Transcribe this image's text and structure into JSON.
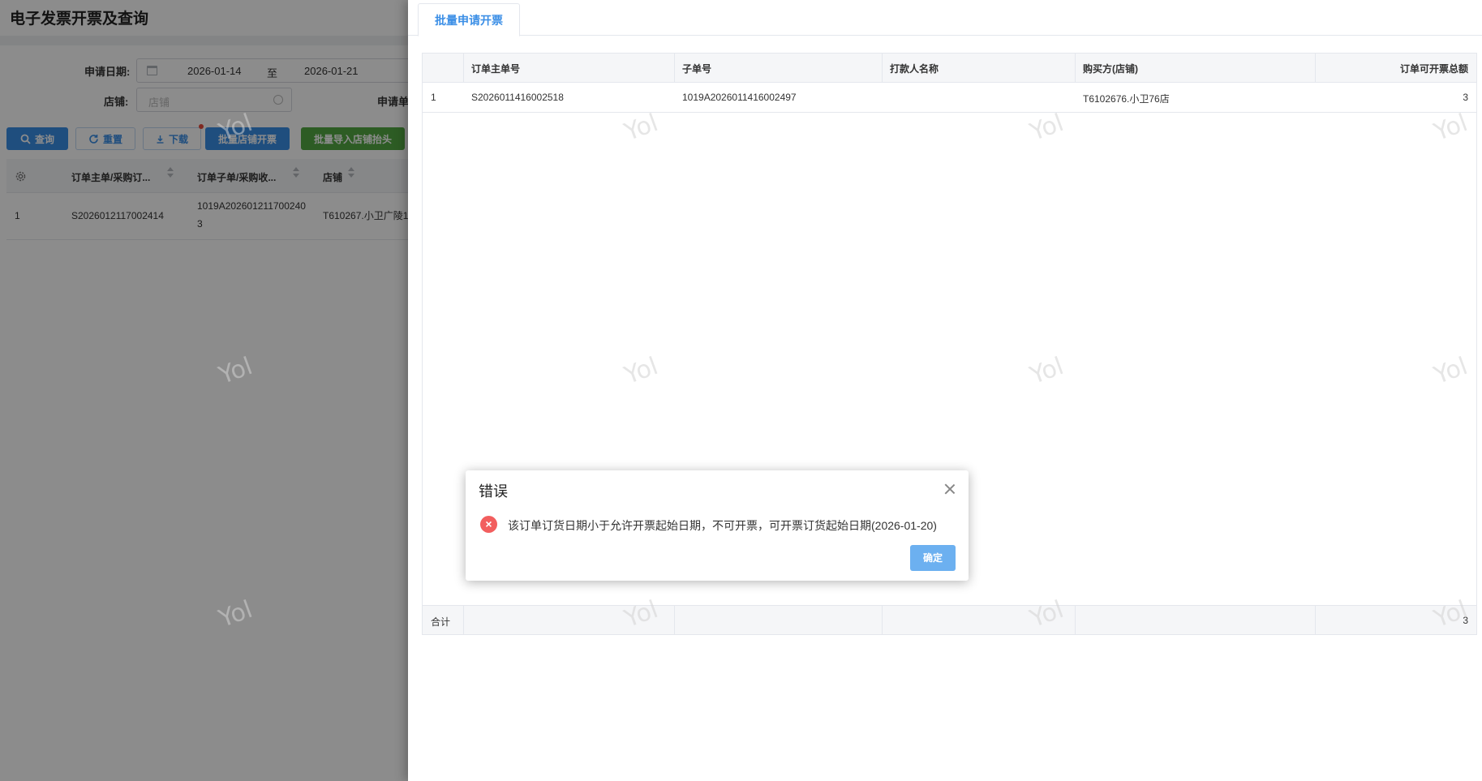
{
  "page": {
    "title": "电子发票开票及查询",
    "filters": {
      "apply_date_label": "申请日期:",
      "date_from": "2026-01-14",
      "date_sep": "至",
      "date_to": "2026-01-21",
      "shop_label": "店铺:",
      "shop_placeholder": "店铺",
      "applicant_label": "申请单"
    },
    "toolbar": {
      "query": "查询",
      "reset": "重置",
      "download": "下载",
      "batch_shop_invoice": "批量店铺开票",
      "batch_import_header": "批量导入店铺抬头"
    },
    "grid": {
      "columns": [
        "订单主单/采购订...",
        "订单子单/采购收...",
        "店铺"
      ],
      "rows": [
        {
          "index": "1",
          "main_order": "S2026012117002414",
          "sub_order_line1": "1019A202601211700240",
          "sub_order_line2": "3",
          "shop": "T610267.小卫广陵1"
        }
      ]
    }
  },
  "drawer": {
    "tab": "批量申请开票",
    "columns": [
      "订单主单号",
      "子单号",
      "打款人名称",
      "购买方(店铺)",
      "订单可开票总额"
    ],
    "rows": [
      {
        "index": "1",
        "main_order": "S2026011416002518",
        "sub_order": "1019A2026011416002497",
        "payer": "",
        "buyer": "T6102676.小卫76店",
        "amount": "3"
      }
    ],
    "footer": {
      "label": "合计",
      "amount": "3"
    }
  },
  "watermark": "Yol",
  "dialog": {
    "title": "错误",
    "message": "该订单订货日期小于允许开票起始日期，不可开票，可开票订货起始日期(2026-01-20)",
    "ok": "确定",
    "icon": "error-icon"
  },
  "colors": {
    "primary": "#3a8ee6",
    "success": "#52a842",
    "error": "#f25e5e",
    "ok_button": "#6cb0f0"
  }
}
